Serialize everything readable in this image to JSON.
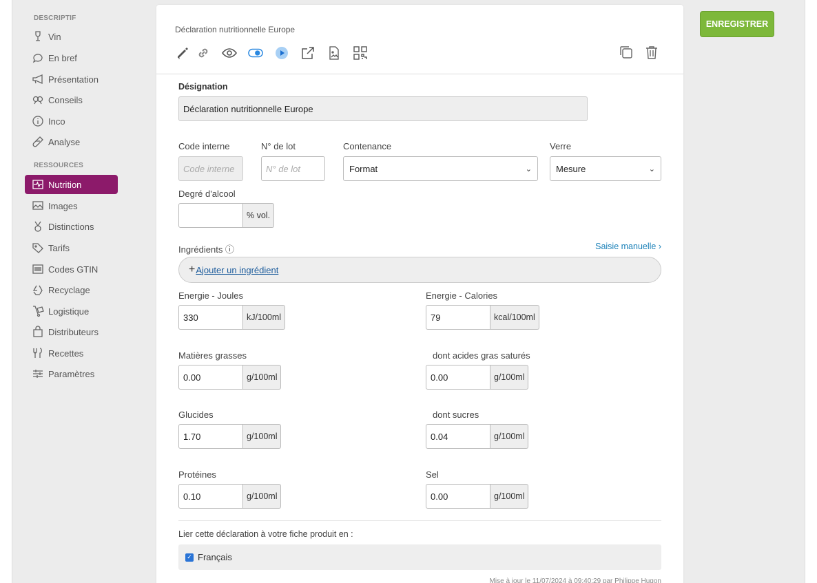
{
  "sidebar": {
    "section1": "DESCRIPTIF",
    "section2": "RESSOURCES",
    "items": [
      {
        "label": "Vin",
        "icon": "wine-glass-icon"
      },
      {
        "label": "En bref",
        "icon": "speech-bubble-icon"
      },
      {
        "label": "Présentation",
        "icon": "megaphone-icon"
      },
      {
        "label": "Conseils",
        "icon": "food-pairing-icon"
      },
      {
        "label": "Inco",
        "icon": "info-circle-icon"
      },
      {
        "label": "Analyse",
        "icon": "test-tube-icon"
      },
      {
        "label": "Nutrition",
        "icon": "pulse-chart-icon",
        "active": true
      },
      {
        "label": "Images",
        "icon": "image-icon"
      },
      {
        "label": "Distinctions",
        "icon": "medal-icon"
      },
      {
        "label": "Tarifs",
        "icon": "price-tag-icon"
      },
      {
        "label": "Codes GTIN",
        "icon": "barcode-icon"
      },
      {
        "label": "Recyclage",
        "icon": "recycle-icon"
      },
      {
        "label": "Logistique",
        "icon": "hand-truck-icon"
      },
      {
        "label": "Distributeurs",
        "icon": "shopping-bag-icon"
      },
      {
        "label": "Recettes",
        "icon": "utensils-icon"
      },
      {
        "label": "Paramètres",
        "icon": "sliders-icon"
      }
    ]
  },
  "card": {
    "title": "Déclaration nutritionnelle Europe",
    "toolbar": [
      "pencil-icon",
      "link-icon",
      "eye-icon",
      "toggle-icon",
      "play-icon",
      "external-link-icon",
      "document-image-icon",
      "qr-code-icon"
    ],
    "toolbar_right": [
      "copy-icon",
      "trash-icon"
    ]
  },
  "form": {
    "designation_label": "Désignation",
    "designation_value": "Déclaration nutritionnelle Europe",
    "code_label": "Code interne",
    "code_placeholder": "Code interne",
    "lot_label": "N° de lot",
    "lot_placeholder": "N° de lot",
    "contenance_label": "Contenance",
    "contenance_value": "Format",
    "verre_label": "Verre",
    "verre_value": "Mesure",
    "alcool_label": "Degré d'alcool",
    "alcool_value": "",
    "alcool_unit": "% vol.",
    "ingredients_label": "Ingrédients ⓘ",
    "saisie_link": "Saisie manuelle ›",
    "add_ingredient": "Ajouter un ingrédient",
    "nutrients": [
      {
        "label": "Energie - Joules",
        "value": "330",
        "unit": "kJ/100ml"
      },
      {
        "label": "Energie - Calories",
        "value": "79",
        "unit": "kcal/100ml"
      },
      {
        "label": "Matières grasses",
        "value": "0.00",
        "unit": "g/100ml"
      },
      {
        "label": "dont acides gras saturés",
        "value": "0.00",
        "unit": "g/100ml"
      },
      {
        "label": "Glucides",
        "value": "1.70",
        "unit": "g/100ml"
      },
      {
        "label": "dont sucres",
        "value": "0.04",
        "unit": "g/100ml"
      },
      {
        "label": "Protéines",
        "value": "0.10",
        "unit": "g/100ml"
      },
      {
        "label": "Sel",
        "value": "0.00",
        "unit": "g/100ml"
      }
    ],
    "link_label": "Lier cette déclaration à votre fiche produit en :",
    "lang_option": "Français",
    "updated_note": "Mise à jour le 11/07/2024 à 09:40:29 par Philippe Hugon"
  },
  "save_label": "ENREGISTRER"
}
